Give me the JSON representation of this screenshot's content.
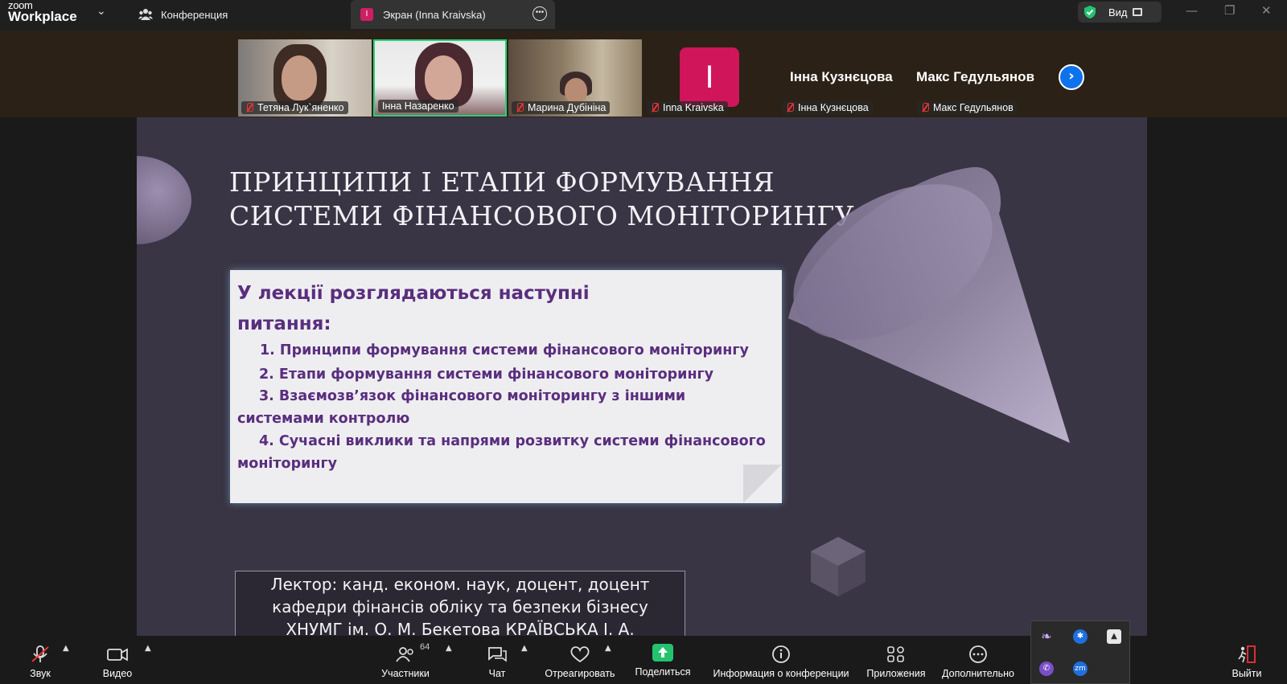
{
  "app": {
    "logo_top": "zoom",
    "logo_bottom": "Workplace"
  },
  "tabs": {
    "conference": "Конференция",
    "screen_badge": "I",
    "screen": "Экран (Inna Kraivska)"
  },
  "view_button": {
    "label": "Вид"
  },
  "participants": [
    {
      "name": "Тетяна Лук`яненко",
      "muted": true
    },
    {
      "name": "Інна Назаренко",
      "muted": false,
      "active_speaker": true
    },
    {
      "name": "Марина Дубініна",
      "muted": true
    },
    {
      "name": "Inna Kraivska",
      "muted": true,
      "avatar_letter": "I",
      "avatar_color": "#d0155a"
    },
    {
      "name": "Інна Кузнєцова",
      "muted": true,
      "big_name": "Інна Кузнєцова"
    },
    {
      "name": "Макс Гедульянов",
      "muted": true,
      "big_name": "Макс Гедульянов"
    }
  ],
  "slide": {
    "title_line1": "ПРИНЦИПИ І ЕТАПИ ФОРМУВАННЯ",
    "title_line2": "СИСТЕМИ ФІНАНСОВОГО МОНІТОРИНГУ",
    "heading_line1": "У лекції розглядаються наступні",
    "heading_line2": "питання:",
    "items": [
      "1. Принципи формування системи фінансового моніторингу",
      "2. Етапи формування системи фінансового моніторингу",
      "3. Взаємозв’язок фінансового моніторингу з іншими системами контролю",
      "4. Сучасні виклики та напрями розвитку системи фінансового моніторингу"
    ],
    "lector_line1": "Лектор: канд. економ. наук, доцент, доцент",
    "lector_line2": "кафедри фінансів обліку та безпеки бізнесу",
    "lector_line3": "ХНУМГ ім. О. М. Бекетова КРАЇВСЬКА І. А."
  },
  "toolbar": {
    "audio": "Звук",
    "video": "Видео",
    "participants": "Участники",
    "participants_count": "64",
    "chat": "Чат",
    "react": "Отреагировать",
    "share": "Поделиться",
    "info": "Информация о конференции",
    "apps": "Приложения",
    "more": "Дополнительно",
    "leave": "Выйти"
  },
  "colors": {
    "accent_green": "#23c36e",
    "speaker_border": "#24d27a",
    "slide_text": "#5a2e7e",
    "next_button": "#0e72ed"
  }
}
